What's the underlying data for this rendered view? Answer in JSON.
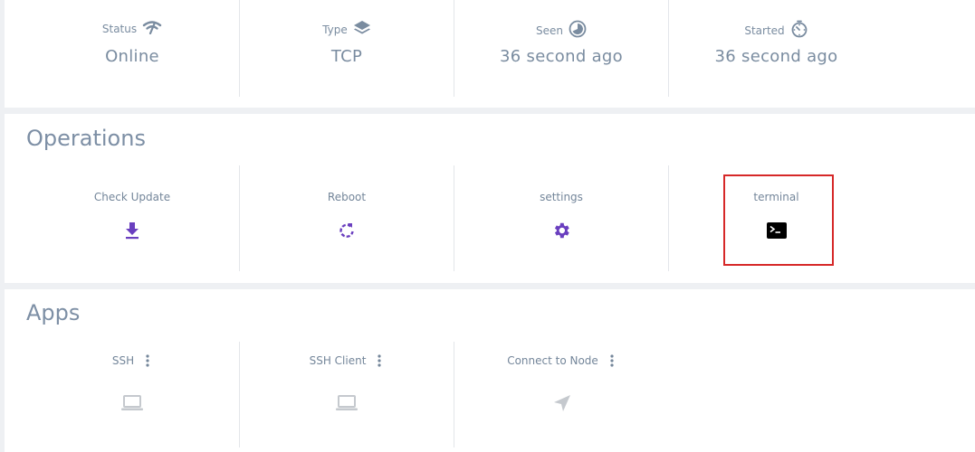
{
  "stats": [
    {
      "label": "Status",
      "value": "Online",
      "icon": "wifi-signal-icon"
    },
    {
      "label": "Type",
      "value": "TCP",
      "icon": "layers-icon"
    },
    {
      "label": "Seen",
      "value": "36 second ago",
      "icon": "pie-clock-icon"
    },
    {
      "label": "Started",
      "value": "36 second ago",
      "icon": "stopwatch-icon"
    }
  ],
  "operations": {
    "title": "Operations",
    "items": [
      {
        "label": "Check Update",
        "icon": "download-icon"
      },
      {
        "label": "Reboot",
        "icon": "reboot-icon"
      },
      {
        "label": "settings",
        "icon": "gear-icon"
      },
      {
        "label": "terminal",
        "icon": "terminal-icon"
      }
    ]
  },
  "apps": {
    "title": "Apps",
    "items": [
      {
        "label": "SSH",
        "icon": "laptop-icon"
      },
      {
        "label": "SSH Client",
        "icon": "laptop-icon"
      },
      {
        "label": "Connect to Node",
        "icon": "send-arrow-icon"
      }
    ]
  },
  "colors": {
    "accent": "#6a3fbf",
    "muted_icon": "#c5c9ce",
    "text": "#73849a",
    "highlight": "#d62828"
  }
}
